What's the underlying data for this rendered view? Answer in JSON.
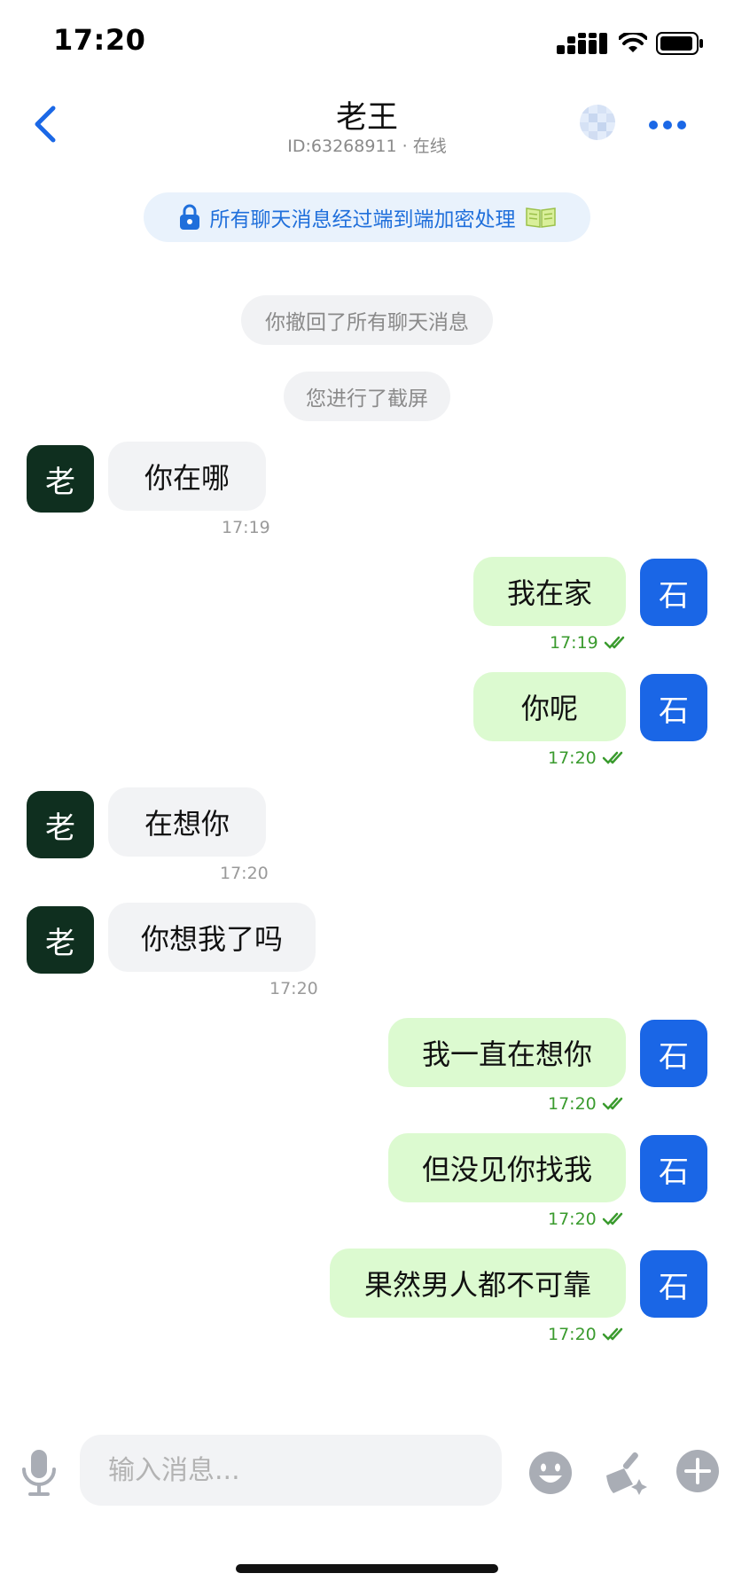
{
  "status_bar": {
    "time": "17:20"
  },
  "header": {
    "title": "老王",
    "subtitle": "ID:63268911 · 在线"
  },
  "encryption_notice": "所有聊天消息经过端到端加密处理",
  "system_notices": [
    "你撤回了所有聊天消息",
    "您进行了截屏"
  ],
  "contact_avatar_char": "老",
  "self_avatar_char": "石",
  "messages": [
    {
      "from": "contact",
      "text": "你在哪",
      "time": "17:19"
    },
    {
      "from": "self",
      "text": "我在家",
      "time": "17:19",
      "read": true
    },
    {
      "from": "self",
      "text": "你呢",
      "time": "17:20",
      "read": true
    },
    {
      "from": "contact",
      "text": "在想你",
      "time": "17:20"
    },
    {
      "from": "contact",
      "text": "你想我了吗",
      "time": "17:20"
    },
    {
      "from": "self",
      "text": "我一直在想你",
      "time": "17:20",
      "read": true
    },
    {
      "from": "self",
      "text": "但没见你找我",
      "time": "17:20",
      "read": true
    },
    {
      "from": "self",
      "text": "果然男人都不可靠",
      "time": "17:20",
      "read": true
    }
  ],
  "input_bar": {
    "placeholder": "输入消息..."
  },
  "colors": {
    "accent": "#1a66e6",
    "outgoing_bubble": "#dcfad0",
    "incoming_bubble": "#f2f3f5",
    "contact_avatar": "#0f2f1f",
    "read_check": "#3a9b2e"
  },
  "icons": [
    "back-chevron-icon",
    "more-icon",
    "lock-icon",
    "book-icon",
    "microphone-icon",
    "emoji-icon",
    "broom-icon",
    "plus-icon",
    "signal-icon",
    "wifi-icon",
    "battery-icon",
    "double-check-icon"
  ]
}
